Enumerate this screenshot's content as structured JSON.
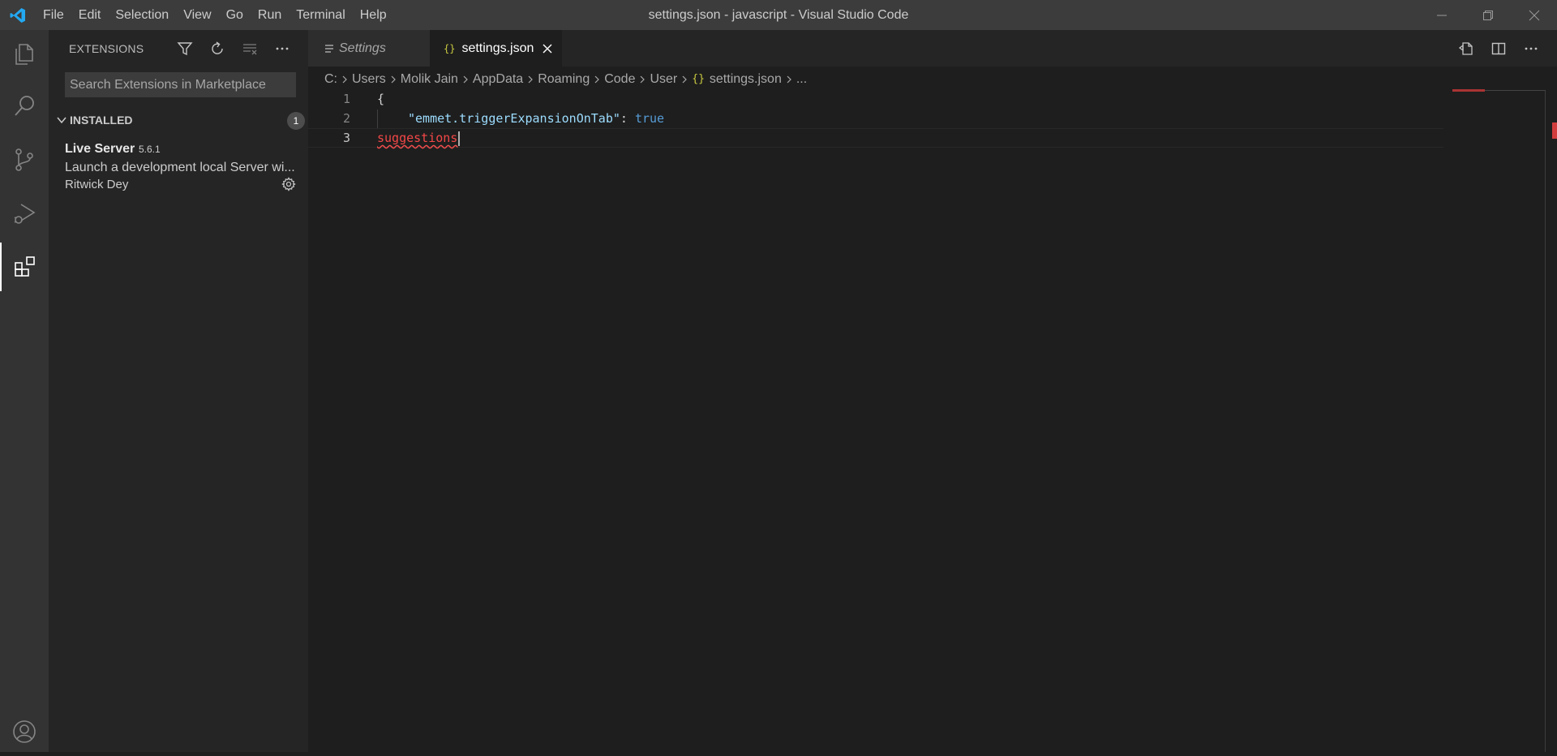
{
  "window": {
    "title": "settings.json - javascript - Visual Studio Code",
    "accent_color": "#0078d4"
  },
  "menu": [
    "File",
    "Edit",
    "Selection",
    "View",
    "Go",
    "Run",
    "Terminal",
    "Help"
  ],
  "window_controls": [
    "minimize-icon",
    "restore-icon",
    "close-icon"
  ],
  "activity_bar": {
    "items": [
      "explorer-icon",
      "search-icon",
      "source-control-icon",
      "run-debug-icon",
      "extensions-icon"
    ],
    "active": "extensions-icon",
    "bottom": "account-icon"
  },
  "sidebar": {
    "title": "EXTENSIONS",
    "actions": [
      "filter-icon",
      "refresh-icon",
      "clear-icon",
      "more-icon"
    ],
    "search_placeholder": "Search Extensions in Marketplace",
    "section": {
      "label": "INSTALLED",
      "count": "1"
    },
    "extension": {
      "name": "Live Server",
      "version": "5.6.1",
      "description": "Launch a development local Server wi...",
      "author": "Ritwick Dey"
    }
  },
  "tabs": [
    {
      "label": "Settings",
      "icon": "settings-file-icon",
      "active": false
    },
    {
      "label": "settings.json",
      "icon": "json-icon",
      "active": true
    }
  ],
  "editor_actions": [
    "open-settings-icon",
    "split-editor-icon",
    "more-icon"
  ],
  "breadcrumb": {
    "items": [
      "C:",
      "Users",
      "Molik Jain",
      "AppData",
      "Roaming",
      "Code",
      "User"
    ],
    "file_icon": "{}",
    "file": "settings.json",
    "trailing": "..."
  },
  "code": {
    "line_numbers": [
      "1",
      "2",
      "3"
    ],
    "line1": "{",
    "line2_key": "\"emmet.triggerExpansionOnTab\"",
    "line2_colon": ": ",
    "line2_value": "true",
    "line3_error": "suggestions"
  }
}
